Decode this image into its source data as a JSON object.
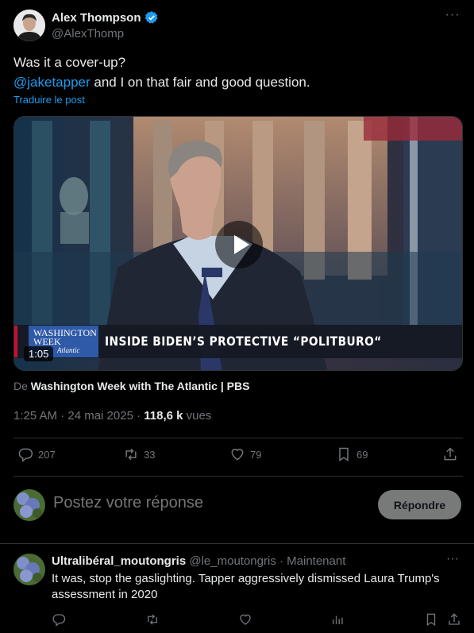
{
  "author": {
    "name": "Alex Thompson",
    "handle": "@AlexThomp",
    "verified": true
  },
  "post": {
    "line1": "Was it a cover-up?",
    "mention": "@jaketapper",
    "line2_rest": " and I on that fair and good question.",
    "translate_label": "Traduire le post",
    "video": {
      "duration": "1:05",
      "headline": "INSIDE BIDEN’S PROTECTIVE “POLITBURO“",
      "logo_line1": "WASHINGTON",
      "logo_line2": "WEEK",
      "logo_line3": "Atlantic"
    },
    "source_prefix": "De ",
    "source_name": "Washington Week with The Atlantic | PBS",
    "time": "1:25 AM · 24 mai 2025 · ",
    "views_count": "118,6 k",
    "views_label": " vues"
  },
  "stats": {
    "replies": "207",
    "reposts": "33",
    "likes": "79",
    "bookmarks": "69"
  },
  "reply_box": {
    "placeholder": "Postez votre réponse",
    "button_label": "Répondre"
  },
  "comment": {
    "name": "Ultralibéral_moutongris",
    "handle_time": " @le_moutongris · Maintenant",
    "text": "It was, stop the gaslighting. Tapper aggressively dismissed Laura Trump's assessment in 2020"
  },
  "colors": {
    "accent": "#1d9bf0",
    "muted": "#71767b",
    "background": "#000000",
    "divider": "#2f3336"
  }
}
